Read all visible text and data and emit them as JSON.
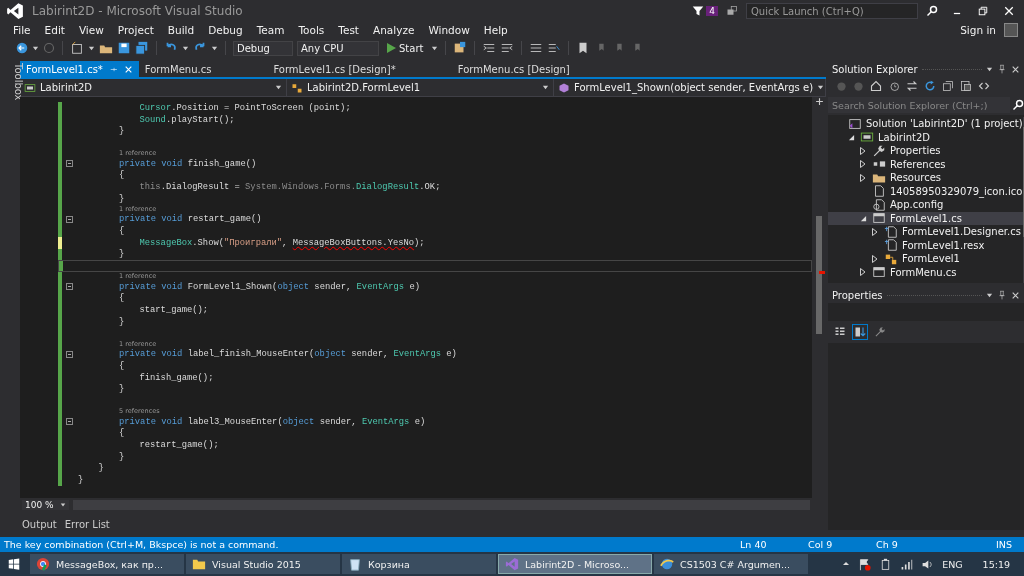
{
  "window": {
    "title": "Labirint2D - Microsoft Visual Studio",
    "notifications": "4",
    "quick_launch": {
      "placeholder": "Quick Launch (Ctrl+Q)"
    }
  },
  "menu": [
    "File",
    "Edit",
    "View",
    "Project",
    "Build",
    "Debug",
    "Team",
    "Tools",
    "Test",
    "Analyze",
    "Window",
    "Help"
  ],
  "account": {
    "label": "Sign in"
  },
  "toolbar": {
    "configuration": "Debug",
    "platform": "Any CPU",
    "start": "Start"
  },
  "toolbox": {
    "label": "Toolbox"
  },
  "editor": {
    "tabs": [
      {
        "label": "FormLevel1.cs*",
        "selected": true
      },
      {
        "label": "FormMenu.cs",
        "selected": false
      },
      {
        "label": "FormLevel1.cs [Design]*",
        "selected": false
      },
      {
        "label": "FormMenu.cs [Design]",
        "selected": false
      }
    ],
    "nav": [
      "Labirint2D",
      "Labirint2D.FormLevel1",
      "FormLevel1_Shown(object sender, EventArgs e)"
    ],
    "code": [
      {
        "kind": "block",
        "children": [
          {
            "kind": "block",
            "children": [
              {
                "kind": "block",
                "children": [
                  {
                    "kind": "code",
                    "fold": false,
                    "unsaved": false,
                    "current": false,
                    "tokens": [
                      {
                        "text": "Cursor",
                        "kind": "type"
                      },
                      {
                        "text": ".Position = PointToScreen (point);",
                        "kind": "plain"
                      }
                    ]
                  },
                  {
                    "kind": "code",
                    "fold": false,
                    "unsaved": false,
                    "current": false,
                    "tokens": [
                      {
                        "text": "Sound",
                        "kind": "type"
                      },
                      {
                        "text": ".playStart();",
                        "kind": "plain"
                      }
                    ]
                  }
                ]
              },
              {
                "kind": "code",
                "fold": false,
                "unsaved": false,
                "current": false,
                "tokens": [
                  {
                    "text": "}",
                    "kind": "plain"
                  }
                ]
              },
              {
                "kind": "blank",
                "unsaved": false,
                "current": false
              },
              {
                "kind": "lens",
                "text": "1 reference",
                "unsaved": false,
                "current": false
              },
              {
                "kind": "code",
                "fold": true,
                "unsaved": false,
                "current": false,
                "tokens": [
                  {
                    "text": "private",
                    "kind": "keyword"
                  },
                  {
                    "text": " void",
                    "kind": "keyword"
                  },
                  {
                    "text": " finish_game()",
                    "kind": "plain"
                  }
                ]
              },
              {
                "kind": "code",
                "fold": false,
                "unsaved": false,
                "current": false,
                "tokens": [
                  {
                    "text": "{",
                    "kind": "plain"
                  }
                ]
              },
              {
                "kind": "block",
                "children": [
                  {
                    "kind": "code",
                    "fold": false,
                    "unsaved": false,
                    "current": false,
                    "tokens": [
                      {
                        "text": "this",
                        "kind": "faded"
                      },
                      {
                        "text": ".DialogResult = ",
                        "kind": "plain"
                      },
                      {
                        "text": "System.Windows.Forms.",
                        "kind": "faded"
                      },
                      {
                        "text": "DialogResult",
                        "kind": "type"
                      },
                      {
                        "text": ".OK;",
                        "kind": "plain"
                      }
                    ]
                  }
                ]
              },
              {
                "kind": "code",
                "fold": false,
                "unsaved": false,
                "current": false,
                "tokens": [
                  {
                    "text": "}",
                    "kind": "plain"
                  }
                ]
              },
              {
                "kind": "lens",
                "text": "1 reference",
                "unsaved": false,
                "current": false
              },
              {
                "kind": "code",
                "fold": true,
                "unsaved": false,
                "current": false,
                "tokens": [
                  {
                    "text": "private",
                    "kind": "keyword"
                  },
                  {
                    "text": " void",
                    "kind": "keyword"
                  },
                  {
                    "text": " restart_game()",
                    "kind": "plain"
                  }
                ]
              },
              {
                "kind": "code",
                "fold": false,
                "unsaved": false,
                "current": false,
                "tokens": [
                  {
                    "text": "{",
                    "kind": "plain"
                  }
                ]
              },
              {
                "kind": "block",
                "children": [
                  {
                    "kind": "code",
                    "fold": false,
                    "unsaved": true,
                    "current": false,
                    "tokens": [
                      {
                        "text": "MessageBox",
                        "kind": "type"
                      },
                      {
                        "text": ".Show(",
                        "kind": "plain"
                      },
                      {
                        "text": "\"Проиграли\"",
                        "kind": "string"
                      },
                      {
                        "text": ", ",
                        "kind": "plain"
                      },
                      {
                        "text": "MessageBoxButtons.YesNo",
                        "kind": "error"
                      },
                      {
                        "text": ");",
                        "kind": "plain"
                      }
                    ]
                  }
                ]
              },
              {
                "kind": "code",
                "fold": false,
                "unsaved": false,
                "current": false,
                "tokens": [
                  {
                    "text": "}",
                    "kind": "plain"
                  }
                ]
              },
              {
                "kind": "blank",
                "unsaved": false,
                "current": true
              },
              {
                "kind": "lens",
                "text": "1 reference",
                "unsaved": false,
                "current": false
              },
              {
                "kind": "code",
                "fold": true,
                "unsaved": false,
                "current": false,
                "tokens": [
                  {
                    "text": "private",
                    "kind": "keyword"
                  },
                  {
                    "text": " void",
                    "kind": "keyword"
                  },
                  {
                    "text": " FormLevel1_Shown(",
                    "kind": "plain"
                  },
                  {
                    "text": "object",
                    "kind": "keyword"
                  },
                  {
                    "text": " sender, ",
                    "kind": "plain"
                  },
                  {
                    "text": "EventArgs",
                    "kind": "type"
                  },
                  {
                    "text": " e)",
                    "kind": "plain"
                  }
                ]
              },
              {
                "kind": "code",
                "fold": false,
                "unsaved": false,
                "current": false,
                "tokens": [
                  {
                    "text": "{",
                    "kind": "plain"
                  }
                ]
              },
              {
                "kind": "block",
                "children": [
                  {
                    "kind": "code",
                    "fold": false,
                    "unsaved": false,
                    "current": false,
                    "tokens": [
                      {
                        "text": "start_game();",
                        "kind": "plain"
                      }
                    ]
                  }
                ]
              },
              {
                "kind": "code",
                "fold": false,
                "unsaved": false,
                "current": false,
                "tokens": [
                  {
                    "text": "}",
                    "kind": "plain"
                  }
                ]
              },
              {
                "kind": "blank",
                "unsaved": false,
                "current": false
              },
              {
                "kind": "lens",
                "text": "1 reference",
                "unsaved": false,
                "current": false
              },
              {
                "kind": "code",
                "fold": true,
                "unsaved": false,
                "current": false,
                "tokens": [
                  {
                    "text": "private",
                    "kind": "keyword"
                  },
                  {
                    "text": " void",
                    "kind": "keyword"
                  },
                  {
                    "text": " label_finish_MouseEnter(",
                    "kind": "plain"
                  },
                  {
                    "text": "object",
                    "kind": "keyword"
                  },
                  {
                    "text": " sender, ",
                    "kind": "plain"
                  },
                  {
                    "text": "EventArgs",
                    "kind": "type"
                  },
                  {
                    "text": " e)",
                    "kind": "plain"
                  }
                ]
              },
              {
                "kind": "code",
                "fold": false,
                "unsaved": false,
                "current": false,
                "tokens": [
                  {
                    "text": "{",
                    "kind": "plain"
                  }
                ]
              },
              {
                "kind": "block",
                "children": [
                  {
                    "kind": "code",
                    "fold": false,
                    "unsaved": false,
                    "current": false,
                    "tokens": [
                      {
                        "text": "finish_game();",
                        "kind": "plain"
                      }
                    ]
                  }
                ]
              },
              {
                "kind": "code",
                "fold": false,
                "unsaved": false,
                "current": false,
                "tokens": [
                  {
                    "text": "}",
                    "kind": "plain"
                  }
                ]
              },
              {
                "kind": "blank",
                "unsaved": false,
                "current": false
              },
              {
                "kind": "lens",
                "text": "5 references",
                "unsaved": false,
                "current": false
              },
              {
                "kind": "code",
                "fold": true,
                "unsaved": false,
                "current": false,
                "tokens": [
                  {
                    "text": "private",
                    "kind": "keyword"
                  },
                  {
                    "text": " void",
                    "kind": "keyword"
                  },
                  {
                    "text": " label3_MouseEnter(",
                    "kind": "plain"
                  },
                  {
                    "text": "object",
                    "kind": "keyword"
                  },
                  {
                    "text": " sender, ",
                    "kind": "plain"
                  },
                  {
                    "text": "EventArgs",
                    "kind": "type"
                  },
                  {
                    "text": " e)",
                    "kind": "plain"
                  }
                ]
              },
              {
                "kind": "code",
                "fold": false,
                "unsaved": false,
                "current": false,
                "tokens": [
                  {
                    "text": "{",
                    "kind": "plain"
                  }
                ]
              },
              {
                "kind": "block",
                "children": [
                  {
                    "kind": "code",
                    "fold": false,
                    "unsaved": false,
                    "current": false,
                    "tokens": [
                      {
                        "text": "restart_game();",
                        "kind": "plain"
                      }
                    ]
                  }
                ]
              },
              {
                "kind": "code",
                "fold": false,
                "unsaved": false,
                "current": false,
                "tokens": [
                  {
                    "text": "}",
                    "kind": "plain"
                  }
                ]
              }
            ]
          },
          {
            "kind": "code",
            "fold": false,
            "unsaved": false,
            "current": false,
            "tokens": [
              {
                "text": "}",
                "kind": "plain"
              }
            ]
          }
        ]
      },
      {
        "kind": "code",
        "fold": false,
        "unsaved": false,
        "current": false,
        "tokens": [
          {
            "text": "}",
            "kind": "plain"
          }
        ]
      }
    ],
    "zoom": "100 %"
  },
  "output_tabs": [
    "Output",
    "Error List"
  ],
  "solution_explorer": {
    "title": "Solution Explorer",
    "search": {
      "placeholder": "Search Solution Explorer (Ctrl+;)"
    },
    "tree": [
      {
        "label": "Solution 'Labirint2D' (1 project)",
        "kind": "solution",
        "selected": false,
        "children": [
          {
            "label": "Labirint2D",
            "kind": "project",
            "expanded": true,
            "selected": false,
            "children": [
              {
                "label": "Properties",
                "kind": "wrench",
                "expanded": false,
                "selected": false
              },
              {
                "label": "References",
                "kind": "references",
                "expanded": false,
                "selected": false
              },
              {
                "label": "Resources",
                "kind": "folder",
                "expanded": false,
                "selected": false
              },
              {
                "label": "14058950329079_icon.ico",
                "kind": "file",
                "selected": false
              },
              {
                "label": "App.config",
                "kind": "config",
                "selected": false
              },
              {
                "label": "FormLevel1.cs",
                "kind": "form",
                "expanded": true,
                "selected": true,
                "children": [
                  {
                    "label": "FormLevel1.Designer.cs",
                    "kind": "code",
                    "expanded": false,
                    "selected": false
                  },
                  {
                    "label": "FormLevel1.resx",
                    "kind": "code",
                    "selected": false
                  },
                  {
                    "label": "FormLevel1",
                    "kind": "class",
                    "expanded": false,
                    "selected": false
                  }
                ]
              },
              {
                "label": "FormMenu.cs",
                "kind": "form",
                "expanded": false,
                "selected": false
              }
            ]
          }
        ]
      }
    ]
  },
  "properties": {
    "title": "Properties"
  },
  "status_bar": {
    "message": "The key combination (Ctrl+M, Bkspce) is not a command.",
    "line": "Ln 40",
    "col": "Col 9",
    "ch": "Ch 9",
    "mode": "INS"
  },
  "taskbar": {
    "items": [
      {
        "label": "MessageBox, как пр...",
        "kind": "browser",
        "selected": false
      },
      {
        "label": "Visual Studio 2015",
        "kind": "folder",
        "selected": false
      },
      {
        "label": "Корзина",
        "kind": "bin",
        "selected": false
      },
      {
        "label": "Labirint2D - Microso...",
        "kind": "studio",
        "selected": true
      },
      {
        "label": "CS1503 C# Argumen...",
        "kind": "globe",
        "selected": false
      }
    ],
    "language": "ENG",
    "time": "15:19"
  }
}
